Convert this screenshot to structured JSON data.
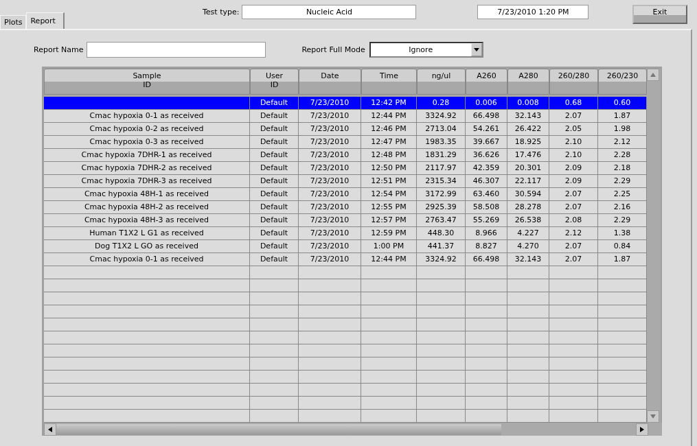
{
  "tabs": [
    {
      "label": "Plots",
      "selected": false
    },
    {
      "label": "Report",
      "selected": true
    }
  ],
  "test_type": {
    "label": "Test type:",
    "value": "Nucleic Acid"
  },
  "datetime": "7/23/2010  1:20 PM",
  "exit_button": "Exit",
  "report_name": {
    "label": "Report Name"
  },
  "report_full_mode": {
    "label": "Report Full Mode",
    "value": "Ignore"
  },
  "table": {
    "columns": [
      "Sample\nID",
      "User\nID",
      "Date",
      "Time",
      "ng/ul",
      "A260",
      "A280",
      "260/280",
      "260/230"
    ],
    "rows": [
      {
        "cells": [
          "",
          "Default",
          "7/23/2010",
          "12:42 PM",
          "0.28",
          "0.006",
          "0.008",
          "0.68",
          "0.60"
        ],
        "selected": true
      },
      {
        "cells": [
          "Cmac hypoxia 0-1 as received",
          "Default",
          "7/23/2010",
          "12:44 PM",
          "3324.92",
          "66.498",
          "32.143",
          "2.07",
          "1.87"
        ],
        "selected": false
      },
      {
        "cells": [
          "Cmac hypoxia 0-2 as received",
          "Default",
          "7/23/2010",
          "12:46 PM",
          "2713.04",
          "54.261",
          "26.422",
          "2.05",
          "1.98"
        ],
        "selected": false
      },
      {
        "cells": [
          "Cmac hypoxia 0-3 as received",
          "Default",
          "7/23/2010",
          "12:47 PM",
          "1983.35",
          "39.667",
          "18.925",
          "2.10",
          "2.12"
        ],
        "selected": false
      },
      {
        "cells": [
          "Cmac hypoxia 7DHR-1 as received",
          "Default",
          "7/23/2010",
          "12:48 PM",
          "1831.29",
          "36.626",
          "17.476",
          "2.10",
          "2.28"
        ],
        "selected": false
      },
      {
        "cells": [
          "Cmac hypoxia 7DHR-2 as received",
          "Default",
          "7/23/2010",
          "12:50 PM",
          "2117.97",
          "42.359",
          "20.301",
          "2.09",
          "2.18"
        ],
        "selected": false
      },
      {
        "cells": [
          "Cmac hypoxia 7DHR-3 as received",
          "Default",
          "7/23/2010",
          "12:51 PM",
          "2315.34",
          "46.307",
          "22.117",
          "2.09",
          "2.29"
        ],
        "selected": false
      },
      {
        "cells": [
          "Cmac hypoxia 48H-1 as received",
          "Default",
          "7/23/2010",
          "12:54 PM",
          "3172.99",
          "63.460",
          "30.594",
          "2.07",
          "2.25"
        ],
        "selected": false
      },
      {
        "cells": [
          "Cmac hypoxia 48H-2 as received",
          "Default",
          "7/23/2010",
          "12:55 PM",
          "2925.39",
          "58.508",
          "28.278",
          "2.07",
          "2.16"
        ],
        "selected": false
      },
      {
        "cells": [
          "Cmac hypoxia 48H-3 as received",
          "Default",
          "7/23/2010",
          "12:57 PM",
          "2763.47",
          "55.269",
          "26.538",
          "2.08",
          "2.29"
        ],
        "selected": false
      },
      {
        "cells": [
          "Human T1X2 L  G1 as received",
          "Default",
          "7/23/2010",
          "12:59 PM",
          "448.30",
          "8.966",
          "4.227",
          "2.12",
          "1.38"
        ],
        "selected": false
      },
      {
        "cells": [
          "Dog T1X2 L  GO as received",
          "Default",
          "7/23/2010",
          "1:00 PM",
          "441.37",
          "8.827",
          "4.270",
          "2.07",
          "0.84"
        ],
        "selected": false
      },
      {
        "cells": [
          "Cmac hypoxia 0-1 as received",
          "Default",
          "7/23/2010",
          "12:44 PM",
          "3324.92",
          "66.498",
          "32.143",
          "2.07",
          "1.87"
        ],
        "selected": false
      }
    ]
  }
}
